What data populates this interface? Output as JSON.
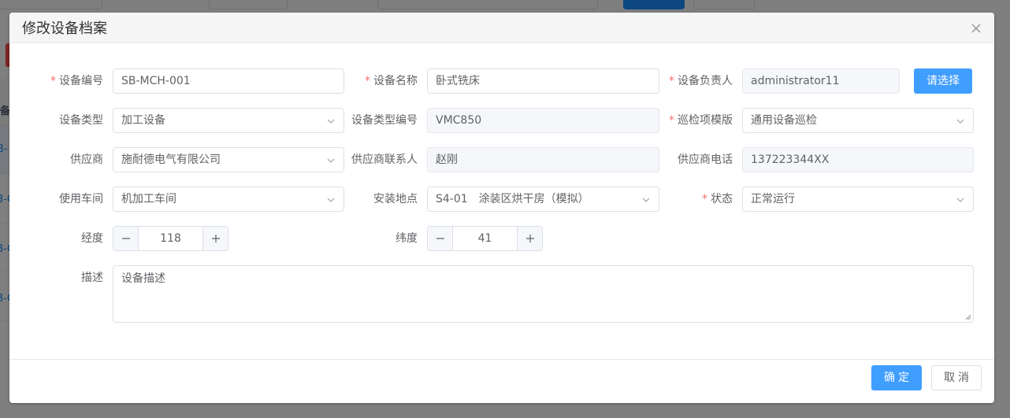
{
  "background": {
    "table_header_fragment": "备",
    "row_link_fragment": "B-",
    "row_link_fragment_alt": "3-C"
  },
  "dialog": {
    "title": "修改设备档案",
    "close_icon": "close-icon"
  },
  "form": {
    "device_code": {
      "label": "设备编号",
      "required": true,
      "value": "SB-MCH-001"
    },
    "device_name": {
      "label": "设备名称",
      "required": true,
      "value": "卧式铣床"
    },
    "device_owner": {
      "label": "设备负责人",
      "required": true,
      "value": "administrator11"
    },
    "choose_button": "请选择",
    "device_type": {
      "label": "设备类型",
      "value": "加工设备"
    },
    "device_type_code": {
      "label": "设备类型编号",
      "value": "VMC850"
    },
    "inspection_template": {
      "label": "巡检项模版",
      "required": true,
      "value": "通用设备巡检"
    },
    "supplier": {
      "label": "供应商",
      "value": "施耐德电气有限公司"
    },
    "supplier_contact": {
      "label": "供应商联系人",
      "value": "赵刚"
    },
    "supplier_phone": {
      "label": "供应商电话",
      "value": "137223344XX"
    },
    "workshop": {
      "label": "使用车间",
      "value": "机加工车间"
    },
    "location": {
      "label": "安装地点",
      "value": "S4-01　涂装区烘干房（模拟）"
    },
    "status": {
      "label": "状态",
      "required": true,
      "value": "正常运行"
    },
    "longitude": {
      "label": "经度",
      "value": "118"
    },
    "latitude": {
      "label": "纬度",
      "value": "41"
    },
    "description": {
      "label": "描述",
      "value": "设备描述"
    }
  },
  "footer": {
    "ok_label": "确定",
    "cancel_label": "取消"
  },
  "colors": {
    "primary": "#409eff",
    "required": "#f56c6c",
    "text": "#606266"
  }
}
